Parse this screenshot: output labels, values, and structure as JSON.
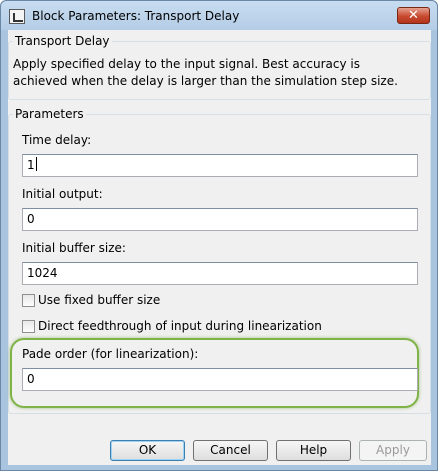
{
  "window": {
    "title": "Block Parameters: Transport Delay",
    "close_glyph": "✕",
    "app_icon": "simulink-block-icon",
    "close_icon": "close-icon"
  },
  "description": {
    "group_title": "Transport Delay",
    "text": "Apply specified delay to the input signal.  Best accuracy is achieved when the delay is larger than the simulation step size."
  },
  "parameters": {
    "group_title": "Parameters",
    "time_delay": {
      "label": "Time delay:",
      "value": "1"
    },
    "initial_output": {
      "label": "Initial output:",
      "value": "0"
    },
    "initial_buffer_size": {
      "label": "Initial buffer size:",
      "value": "1024"
    },
    "use_fixed_buffer": {
      "label": "Use fixed buffer size",
      "checked": false
    },
    "direct_feedthrough": {
      "label": "Direct feedthrough of input during linearization",
      "checked": false
    },
    "pade_order": {
      "label": "Pade order (for linearization):",
      "value": "0"
    }
  },
  "buttons": {
    "ok": "OK",
    "cancel": "Cancel",
    "help": "Help",
    "apply": "Apply"
  },
  "colors": {
    "highlight": "#7fb347",
    "titlebar": "#b4cde6",
    "close": "#c84a2f"
  }
}
